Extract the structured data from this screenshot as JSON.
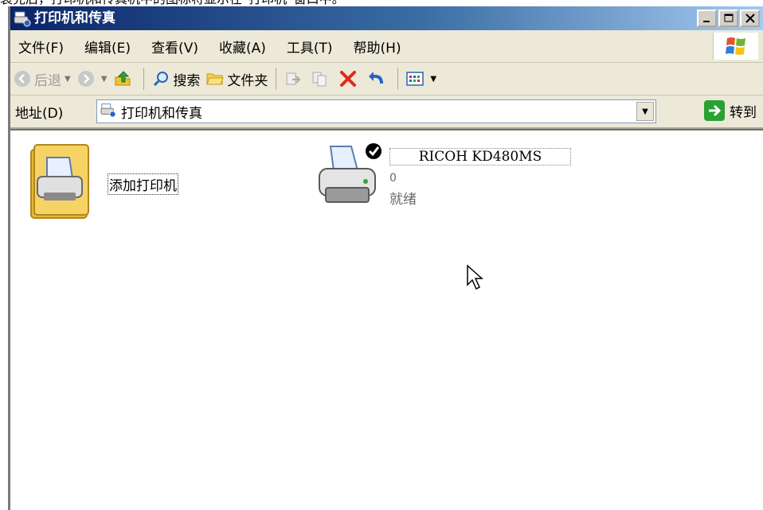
{
  "caption": "装完后，打印机和传真机中的图标将显示在“打印机”窗口中。",
  "window": {
    "title": "打印机和传真"
  },
  "menu": [
    "文件(F)",
    "编辑(E)",
    "查看(V)",
    "收藏(A)",
    "工具(T)",
    "帮助(H)"
  ],
  "toolbar": {
    "back": "后退",
    "search": "搜索",
    "folders": "文件夹"
  },
  "address": {
    "label": "地址(D)",
    "value": "打印机和传真",
    "go": "转到"
  },
  "items": {
    "add_printer": {
      "label": "添加打印机"
    },
    "printer": {
      "name": "RICOH KD480MS",
      "count": "0",
      "status": "就绪"
    }
  }
}
